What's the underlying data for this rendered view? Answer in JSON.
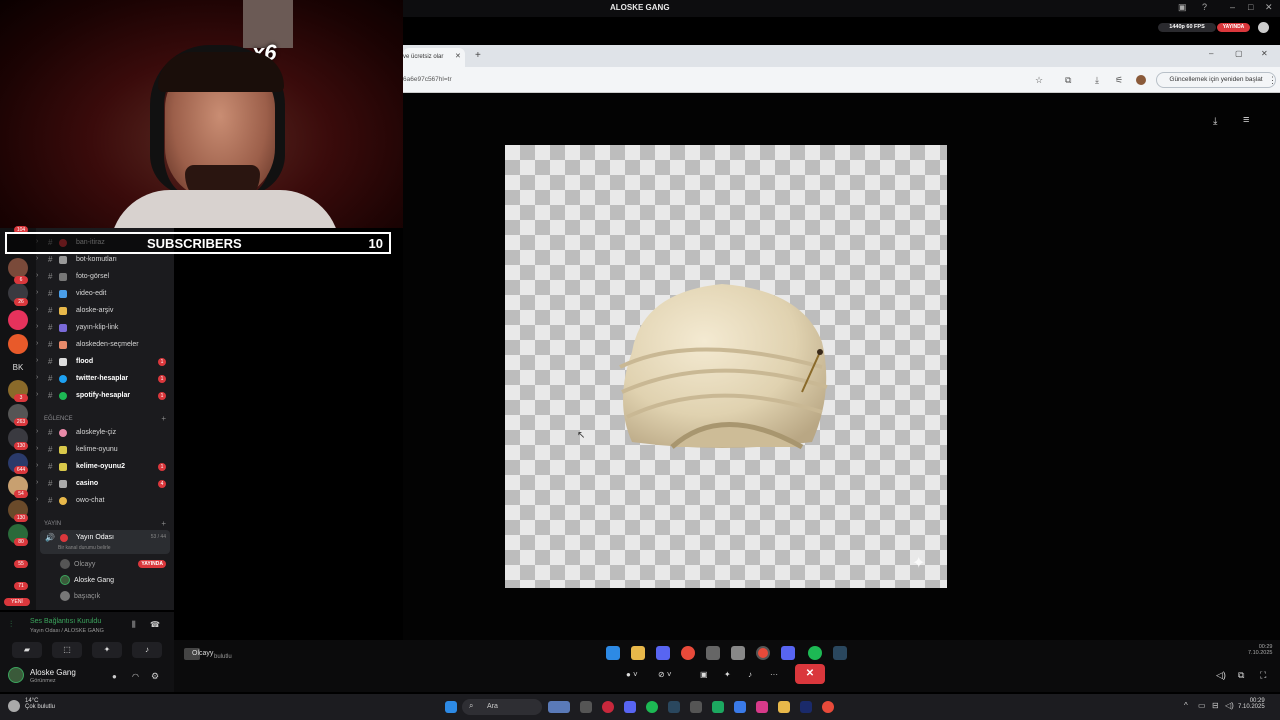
{
  "window": {
    "title": "ALOSKE GANG"
  },
  "stream": {
    "resolution": "1440p 60 FPS",
    "live_badge": "YAYINDA"
  },
  "webcam": {
    "meme_text": "x6"
  },
  "subscribers": {
    "label": "SUBSCRIBERS",
    "count": "10"
  },
  "channels": [
    {
      "name": "ban-itiraz",
      "mention": ""
    },
    {
      "name": "bot-komutları",
      "mention": ""
    },
    {
      "name": "foto-görsel",
      "mention": ""
    },
    {
      "name": "video-edit",
      "mention": ""
    },
    {
      "name": "aloske-arşiv",
      "mention": ""
    },
    {
      "name": "yayın-klip-link",
      "mention": ""
    },
    {
      "name": "aloskeden-seçmeler",
      "mention": ""
    },
    {
      "name": "flood",
      "mention": "1"
    },
    {
      "name": "twitter-hesaplar",
      "mention": "1"
    },
    {
      "name": "spotify-hesaplar",
      "mention": "1"
    }
  ],
  "categories": {
    "eglence": "EĞLENCE",
    "yayin": "YAYIN"
  },
  "fun_channels": [
    {
      "name": "aloskeyle-çiz",
      "mention": ""
    },
    {
      "name": "kelime-oyunu",
      "mention": ""
    },
    {
      "name": "kelime-oyunu2",
      "mention": "1"
    },
    {
      "name": "casino",
      "mention": "4"
    },
    {
      "name": "owo-chat",
      "mention": ""
    }
  ],
  "voice_channel": {
    "name": "Yayın Odası",
    "count": "53 / 44",
    "status": "Bir kanal durumu belirle"
  },
  "voice_users": [
    {
      "name": "Olcayy",
      "badge": "YAYINDA"
    },
    {
      "name": "Aloske Gang",
      "badge": ""
    },
    {
      "name": "başıaçık",
      "badge": ""
    }
  ],
  "rail_badges": [
    "104",
    "6",
    "26",
    "3",
    "263",
    "130",
    "644",
    "54",
    "130",
    "80",
    "55",
    "71",
    "YENİ"
  ],
  "voice_panel": {
    "status": "Ses Bağlantısı Kuruldu",
    "sub": "Yayın Odası / ALOSKE GANG",
    "user": "Aloske Gang",
    "user_status": "Görünmez"
  },
  "browser": {
    "tab_label": "ve ücretsiz olar",
    "url": "6a6e97c567hl=tr",
    "update_button": "Güncellemek için yeniden başlat"
  },
  "ctrlbar": {
    "user": "Olcayy",
    "sub": "bulutlu",
    "clock_time": "00:29",
    "clock_date": "7.10.2025"
  },
  "taskbar": {
    "temp": "14°C",
    "weather": "Çok bulutlu",
    "search": "Ara",
    "time": "00:29",
    "date": "7.10.2025"
  }
}
